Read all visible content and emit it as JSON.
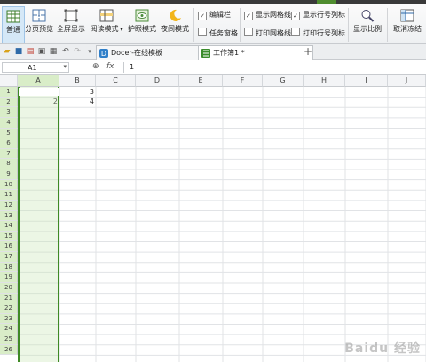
{
  "ribbon": {
    "view_buttons": [
      {
        "label": "普通",
        "icon": "normal-view-icon"
      },
      {
        "label": "分页预览",
        "icon": "page-break-preview-icon"
      },
      {
        "label": "全屏显示",
        "icon": "full-screen-icon"
      },
      {
        "label": "阅读模式",
        "icon": "reading-mode-icon"
      },
      {
        "label": "护眼模式",
        "icon": "eye-protection-icon"
      },
      {
        "label": "夜间模式",
        "icon": "night-mode-icon"
      }
    ],
    "checkboxes": [
      {
        "label": "编辑栏",
        "checked": true
      },
      {
        "label": "任务窗格",
        "checked": false
      },
      {
        "label": "显示网格线",
        "checked": true
      },
      {
        "label": "打印网格线",
        "checked": false
      },
      {
        "label": "显示行号列标",
        "checked": true
      },
      {
        "label": "打印行号列标",
        "checked": false
      }
    ],
    "zoom_label": "显示比例",
    "freeze_label": "取消冻结",
    "checkmark": "✓"
  },
  "tabs": [
    {
      "label": "Docer-在线模板",
      "close": "×",
      "icon": "docer-icon"
    },
    {
      "label": "工作簿1 *",
      "close": "",
      "icon": "spreadsheet-icon"
    }
  ],
  "new_tab_symbol": "+",
  "quick_access": [
    "folder-icon",
    "save-icon",
    "pdf-icon",
    "print-preview-icon",
    "print-icon",
    "undo-icon",
    "redo-icon",
    "dropdown-icon"
  ],
  "formula_bar": {
    "cell_ref": "A1",
    "fx_label": "fx",
    "zoom_symbol": "⊕",
    "value": "1"
  },
  "columns": [
    "A",
    "B",
    "C",
    "D",
    "E",
    "F",
    "G",
    "H",
    "I",
    "J"
  ],
  "rows": [
    "1",
    "2",
    "3",
    "4",
    "5",
    "6",
    "7",
    "8",
    "9",
    "10",
    "11",
    "12",
    "13",
    "14",
    "15",
    "16",
    "17",
    "18",
    "19",
    "20",
    "21",
    "22",
    "23",
    "24",
    "25",
    "26"
  ],
  "cells": {
    "A1": "1",
    "B1": "3",
    "A2": "2",
    "B2": "4"
  },
  "watermark": "Baidu 经验",
  "colors": {
    "accent_green": "#4f8d2f",
    "selection_green": "#d9edc8",
    "selection_border": "#3f8a25"
  }
}
